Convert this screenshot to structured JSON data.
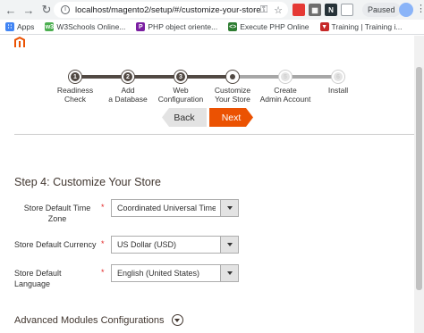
{
  "browser": {
    "url_host": "localhost",
    "url_path": "/magento2/setup/#/customize-your-store",
    "profile_status": "Paused",
    "bookmarks": [
      {
        "label": "Apps",
        "icon": "apps-grid-icon",
        "color": "#4285f4"
      },
      {
        "label": "W3Schools Online...",
        "icon": "w3schools-icon",
        "color": "#4caf50"
      },
      {
        "label": "PHP object oriente...",
        "icon": "php-icon",
        "color": "#7b1fa2"
      },
      {
        "label": "Execute PHP Online",
        "icon": "code-icon",
        "color": "#2e7d32"
      },
      {
        "label": "Training | Training i...",
        "icon": "training-icon",
        "color": "#c62828"
      }
    ]
  },
  "wizard": {
    "steps": [
      {
        "number": "1",
        "label_line1": "Readiness",
        "label_line2": "Check",
        "state": "done"
      },
      {
        "number": "2",
        "label_line1": "Add",
        "label_line2": "a Database",
        "state": "done"
      },
      {
        "number": "3",
        "label_line1": "Web",
        "label_line2": "Configuration",
        "state": "done"
      },
      {
        "number": "4",
        "label_line1": "Customize",
        "label_line2": "Your Store",
        "state": "active"
      },
      {
        "number": "5",
        "label_line1": "Create",
        "label_line2": "Admin Account",
        "state": "todo"
      },
      {
        "number": "6",
        "label_line1": "Install",
        "label_line2": "",
        "state": "todo"
      }
    ],
    "back_label": "Back",
    "next_label": "Next"
  },
  "form": {
    "title": "Step 4: Customize Your Store",
    "timezone_label_line1": "Store Default Time",
    "timezone_label_line2": "Zone",
    "timezone_value": "Coordinated Universal Time (",
    "currency_label": "Store Default Currency",
    "currency_value": "US Dollar (USD)",
    "language_label": "Store Default Language",
    "language_value": "English (United States)",
    "required_mark": "*"
  },
  "advanced": {
    "label": "Advanced Modules Configurations"
  },
  "colors": {
    "accent": "#eb5202",
    "step_done": "#514943",
    "required": "#e22626"
  }
}
